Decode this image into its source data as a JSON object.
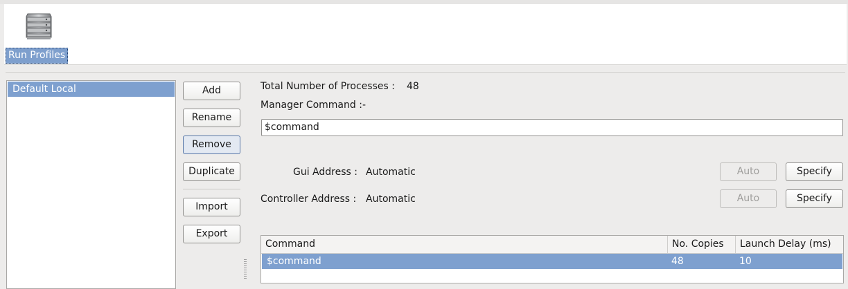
{
  "toolbar": {
    "run_profiles_label": "Run Profiles",
    "icon": "server-icon"
  },
  "profiles": [
    {
      "label": "Default Local",
      "selected": true
    }
  ],
  "buttons": {
    "add": "Add",
    "rename": "Rename",
    "remove": "Remove",
    "duplicate": "Duplicate",
    "import": "Import",
    "export": "Export"
  },
  "details": {
    "total_processes_label": "Total Number of Processes :",
    "total_processes_value": "48",
    "manager_command_label": "Manager Command :-",
    "manager_command_value": "$command",
    "gui_address_label": "Gui Address :",
    "gui_address_value": "Automatic",
    "controller_address_label": "Controller Address :",
    "controller_address_value": "Automatic",
    "auto_label": "Auto",
    "specify_label": "Specify"
  },
  "table": {
    "headers": [
      "Command",
      "No. Copies",
      "Launch Delay (ms)"
    ],
    "rows": [
      [
        "$command",
        "48",
        "10"
      ]
    ]
  },
  "colors": {
    "selection": "#7ea0cf",
    "background": "#edeceb"
  }
}
